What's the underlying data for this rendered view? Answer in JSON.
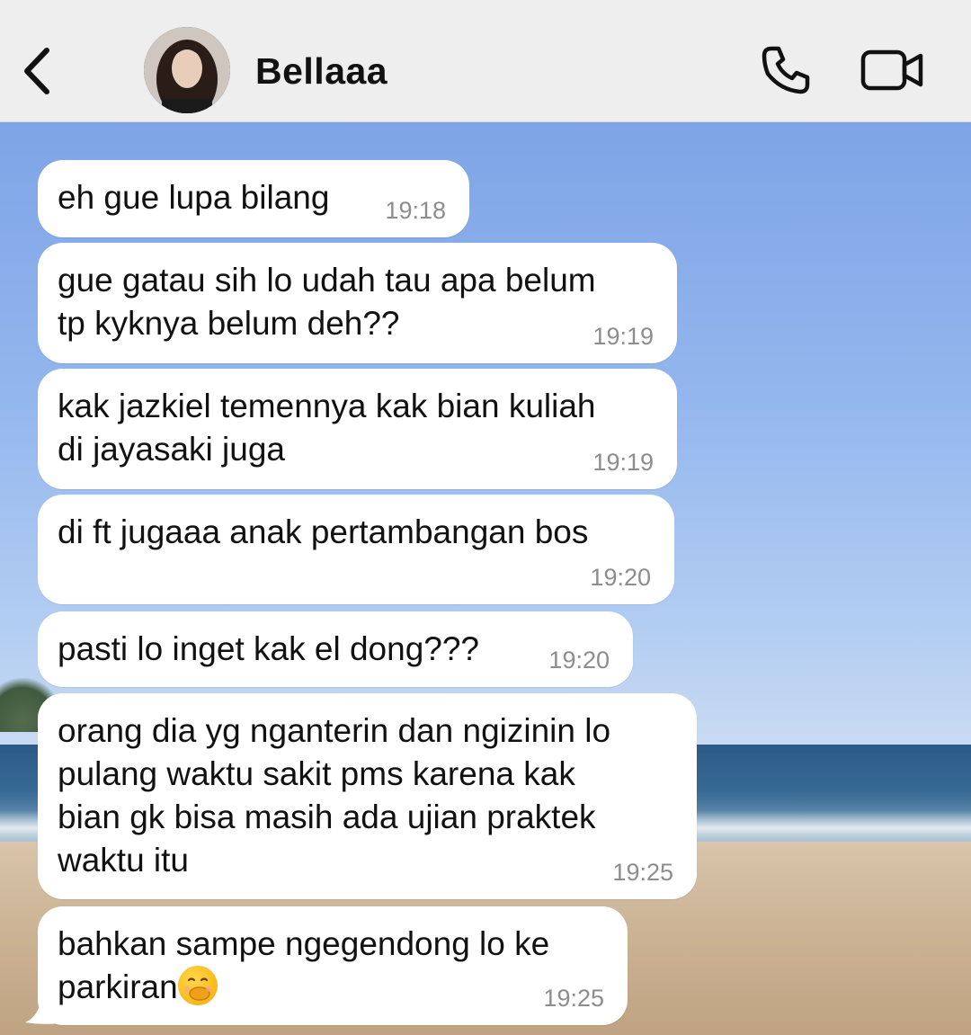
{
  "header": {
    "contact_name": "Bellaaa",
    "back_icon": "chevron-left-icon",
    "call_icon": "phone-icon",
    "video_icon": "video-camera-icon"
  },
  "messages": [
    {
      "text": "eh gue lupa bilang",
      "time": "19:18"
    },
    {
      "text": "gue gatau sih lo udah tau apa belum\ntp kyknya belum deh??",
      "time": "19:19"
    },
    {
      "text": "kak jazkiel temennya kak bian kuliah\ndi jayasaki juga",
      "time": "19:19"
    },
    {
      "text": "di ft jugaaa anak pertambangan bos",
      "time": "19:20"
    },
    {
      "text": "pasti lo inget kak el dong???",
      "time": "19:20"
    },
    {
      "text": "orang dia yg nganterin dan ngizinin lo\npulang waktu sakit pms karena kak\nbian gk bisa masih ada ujian praktek\nwaktu itu",
      "time": "19:25"
    },
    {
      "text": "bahkan sampe ngegendong lo ke\nparkiran",
      "emoji": "face-with-hand-over-mouth-emoji",
      "time": "19:25"
    }
  ]
}
